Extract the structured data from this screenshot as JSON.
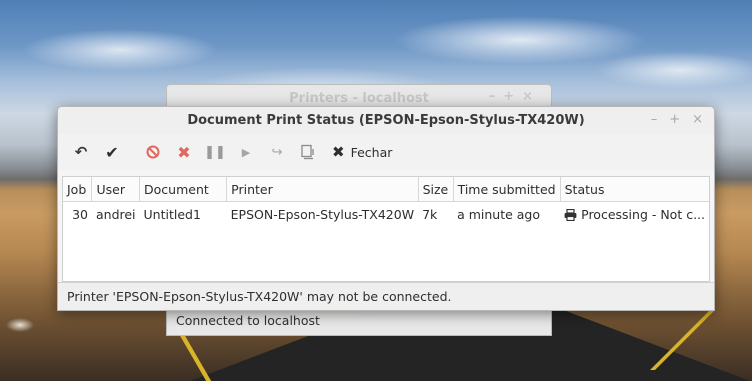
{
  "background_window": {
    "title": "Printers - localhost",
    "controls": [
      "–",
      "+",
      "×"
    ],
    "status": "Connected to localhost"
  },
  "window": {
    "title": "Document Print Status (EPSON-Epson-Stylus-TX420W)",
    "controls": {
      "minimize": "–",
      "maximize": "+",
      "close": "×"
    }
  },
  "toolbar": {
    "refresh_icon": "refresh-icon",
    "authenticate_icon": "check-icon",
    "cancel_icon": "cancel-icon",
    "delete_icon": "delete-icon",
    "hold_icon": "pause-icon",
    "release_icon": "play-icon",
    "reprint_icon": "reprint-icon",
    "attributes_icon": "attributes-icon",
    "close_label": "Fechar"
  },
  "table": {
    "columns": [
      "Job",
      "User",
      "Document",
      "Printer",
      "Size",
      "Time submitted",
      "Status"
    ],
    "rows": [
      {
        "job": "30",
        "user": "andrei",
        "document": "Untitled1",
        "printer": "EPSON-Epson-Stylus-TX420W",
        "size": "7k",
        "time": "a minute ago",
        "status": "Processing - Not c..."
      }
    ]
  },
  "statusbar": {
    "message": "Printer 'EPSON-Epson-Stylus-TX420W' may not be connected."
  },
  "colors": {
    "accent_red": "#e0685c",
    "window_bg": "#f5f5f5",
    "text": "#2e2e2e"
  }
}
